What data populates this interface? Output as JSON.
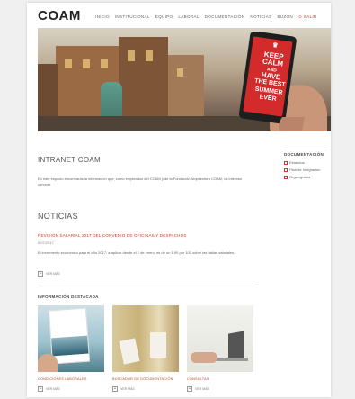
{
  "header": {
    "logo": "COAM",
    "nav": [
      "INICIO",
      "INSTITUCIONAL",
      "EQUIPO",
      "LABORAL",
      "DOCUMENTACIÓN",
      "NOTICIAS",
      "BUZÓN"
    ],
    "logout": "⊙ SALIR"
  },
  "hero": {
    "poster_lines": [
      "KEEP",
      "CALM",
      "AND",
      "HAVE",
      "THE BEST",
      "SUMMER",
      "EVER"
    ]
  },
  "intranet": {
    "title": "INTRANET COAM",
    "text": "En este espacio encontrarás la información que, como empleados del COAM y de la Fundación Arquitectura COAM, os interesa conocer."
  },
  "sidebar": {
    "title": "DOCUMENTACIÓN",
    "items": [
      "Estatutos",
      "Plan de Integración",
      "Organigrama"
    ]
  },
  "news": {
    "section_title": "NOTICIAS",
    "headline": "REVISIÓN SALARIAL 2017 DEL CONVENIO DE OFICINAS Y DESPACHOS",
    "date": "5/07/2017",
    "body": "El incremento económico para el año 2017, a aplicar desde el 1 de enero, es de un 1,90 por 100 sobre las tablas salariales.",
    "more": "VER MÁS"
  },
  "featured": {
    "title": "INFORMACIÓN DESTACADA",
    "cards": [
      {
        "label": "CONDICIONES LABORALES",
        "more": "VER MÁS"
      },
      {
        "label": "BUSCADOR DE DOCUMENTACIÓN",
        "more": "VER MÁS"
      },
      {
        "label": "CONSULTAS",
        "more": "VER MÁS"
      }
    ]
  },
  "colors": {
    "accent": "#c0392b",
    "poster": "#d32b2b"
  }
}
